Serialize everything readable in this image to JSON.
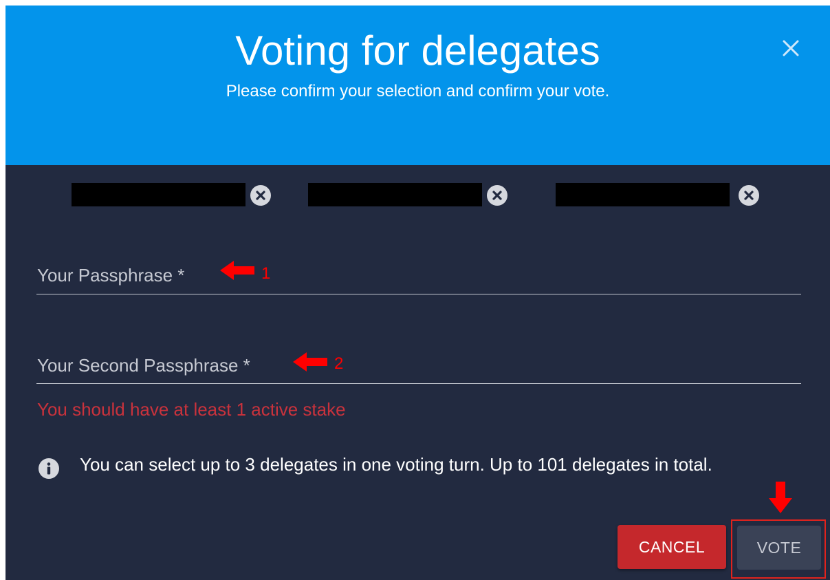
{
  "dialog": {
    "title": "Voting for delegates",
    "subtitle": "Please confirm your selection and confirm your vote.",
    "close_icon": "close-icon"
  },
  "selected_delegates": [
    {
      "name": "",
      "redacted": true,
      "remove_icon": "remove-circle-icon"
    },
    {
      "name": "",
      "redacted": true,
      "remove_icon": "remove-circle-icon"
    },
    {
      "name": "",
      "redacted": true,
      "remove_icon": "remove-circle-icon"
    }
  ],
  "form": {
    "passphrase_label": "Your Passphrase *",
    "second_passphrase_label": "Your Second Passphrase *",
    "error_message": "You should have at least 1 active stake"
  },
  "info": {
    "icon": "info-icon",
    "text": "You can select up to 3 delegates in one voting turn. Up to 101 delegates in total."
  },
  "actions": {
    "cancel_label": "CANCEL",
    "vote_label": "VOTE"
  },
  "annotations": {
    "step1": "1",
    "step2": "2"
  },
  "colors": {
    "header": "#0394eb",
    "body": "#222a40",
    "error": "#c9323c",
    "cancel": "#c5282c",
    "vote": "#3a4256",
    "annotation": "#ff0000"
  }
}
